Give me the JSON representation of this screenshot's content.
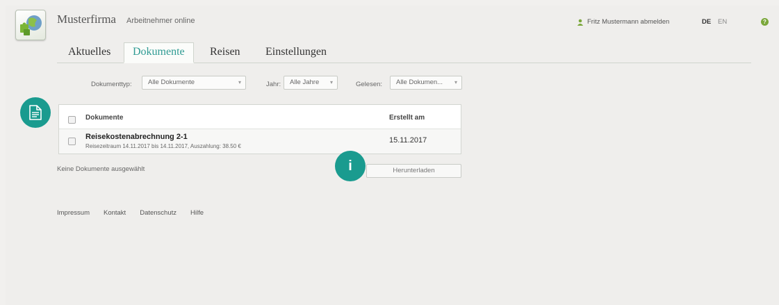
{
  "header": {
    "brand": "Musterfirma",
    "subtitle": "Arbeitnehmer online",
    "user_logout": "Fritz Mustermann abmelden",
    "languages": [
      "DE",
      "EN"
    ],
    "help_symbol": "?"
  },
  "tabs": [
    {
      "label": "Aktuelles"
    },
    {
      "label": "Dokumente",
      "active": true
    },
    {
      "label": "Reisen"
    },
    {
      "label": "Einstellungen"
    }
  ],
  "filters": {
    "type_label": "Dokumenttyp:",
    "type_value": "Alle Dokumente",
    "year_label": "Jahr:",
    "year_value": "Alle Jahre",
    "read_label": "Gelesen:",
    "read_value": "Alle Dokumen..."
  },
  "table": {
    "col_documents": "Dokumente",
    "col_created": "Erstellt am",
    "rows": [
      {
        "title": "Reisekostenabrechnung 2-1",
        "subtitle": "Reisezeitraum 14.11.2017 bis 14.11.2017, Auszahlung: 38.50 €",
        "date": "15.11.2017"
      }
    ]
  },
  "status": {
    "none_selected": "Keine Dokumente ausgewählt",
    "download": "Herunterladen",
    "info_symbol": "i"
  },
  "footer": [
    "Impressum",
    "Kontakt",
    "Datenschutz",
    "Hilfe"
  ],
  "colors": {
    "accent": "#1a9b8f",
    "active_tab": "#2f9b93",
    "user_icon": "#7aa73a"
  },
  "icons": {
    "logo": "globe-puzzle-logo",
    "user": "user-icon",
    "help": "help-icon",
    "document": "document-icon",
    "info": "info-icon"
  }
}
